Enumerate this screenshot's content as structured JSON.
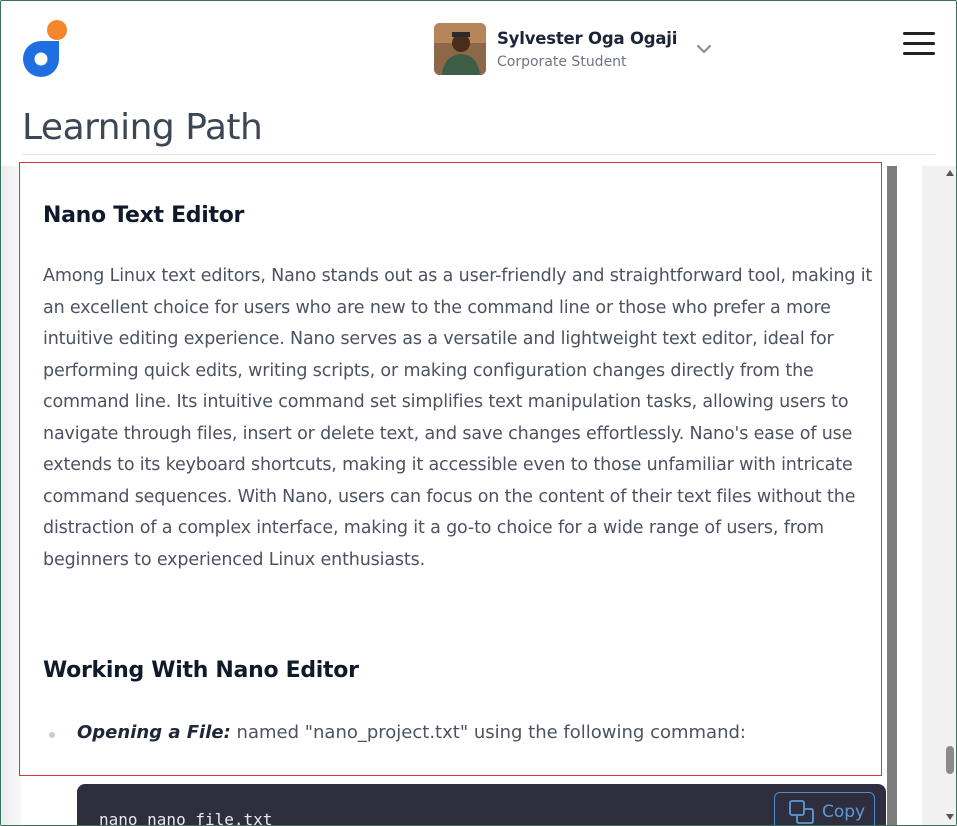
{
  "header": {
    "user_name": "Sylvester Oga Ogaji",
    "user_role": "Corporate Student"
  },
  "page": {
    "title": "Learning Path"
  },
  "content": {
    "section_heading": "Nano Text Editor",
    "paragraph": "Among Linux text editors, Nano stands out as a user-friendly and straightforward tool, making it an excellent choice for users who are new to the command line or those who prefer a more intuitive editing experience. Nano serves as a versatile and lightweight text editor, ideal for performing quick edits, writing scripts, or making configuration changes directly from the command line. Its intuitive command set simplifies text manipulation tasks, allowing users to navigate through files, insert or delete text, and save changes effortlessly. Nano's ease of use extends to its keyboard shortcuts, making it accessible even to those unfamiliar with intricate command sequences. With Nano, users can focus on the content of their text files without the distraction of a complex interface, making it a go-to choice for a wide range of users, from beginners to experienced Linux enthusiasts.",
    "subheading": "Working With Nano Editor",
    "bullet_label": "Opening a File:",
    "bullet_text": " named \"nano_project.txt\" using the following command:",
    "code": "nano nano_file.txt",
    "copy_label": "Copy"
  },
  "colors": {
    "logo_blue": "#1f6fe0",
    "logo_orange": "#f5862a",
    "highlight_border": "#e0353b",
    "code_bg": "#2f2e3e",
    "copy_accent": "#4f8ccf"
  },
  "icons": [
    "logo-icon",
    "chevron-down-icon",
    "hamburger-menu-icon",
    "copy-icon"
  ]
}
